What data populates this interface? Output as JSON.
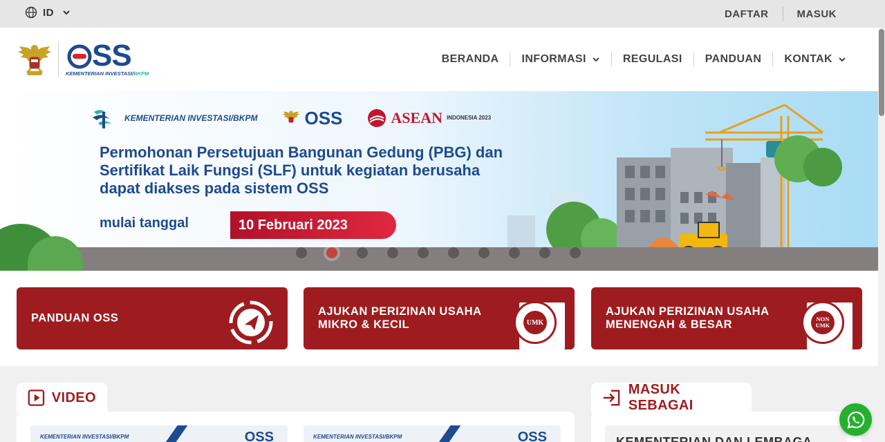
{
  "topbar": {
    "language": "ID",
    "links": [
      "DAFTAR",
      "MASUK"
    ]
  },
  "header": {
    "logo_text": "OSS",
    "logo_subtitle": "KEMENTERIAN INVESTASI/",
    "logo_subtitle_accent": "BKPM",
    "nav": [
      {
        "label": "BERANDA",
        "dropdown": false
      },
      {
        "label": "INFORMASI",
        "dropdown": true
      },
      {
        "label": "REGULASI",
        "dropdown": false
      },
      {
        "label": "PANDUAN",
        "dropdown": false
      },
      {
        "label": "KONTAK",
        "dropdown": true
      }
    ]
  },
  "banner": {
    "logo_kementerian": "KEMENTERIAN INVESTASI/BKPM",
    "logo_oss": "OSS",
    "logo_asean": "ASEAN",
    "logo_asean_sub": "INDONESIA 2023",
    "title": "Permohonan Persetujuan Bangunan Gedung (PBG) dan Sertifikat Laik Fungsi (SLF) untuk kegiatan berusaha dapat diakses pada sistem OSS",
    "date_prefix": "mulai tanggal",
    "date": "10 Februari 2023",
    "slide_count": 10,
    "active_slide": 1
  },
  "cards": [
    {
      "label": "PANDUAN OSS",
      "icon": "compass-icon"
    },
    {
      "label": "AJUKAN PERIZINAN USAHA MIKRO & KECIL",
      "icon": "umk-seal-icon",
      "seal": "UMK",
      "ring": "USAHA MIKRO & KECIL"
    },
    {
      "label": "AJUKAN PERIZINAN USAHA MENENGAH & BESAR",
      "icon": "non-umk-seal-icon",
      "seal": "NON UMK",
      "ring": "USAHA MENENGAH & BESAR"
    }
  ],
  "sections": {
    "video_title": "VIDEO",
    "masuk_title": "MASUK SEBAGAI",
    "masuk_first_option": "KEMENTERIAN DAN LEMBAGA",
    "video_thumb_kementerian": "KEMENTERIAN INVESTASI/BKPM",
    "video_thumb_oss": "OSS"
  },
  "colors": {
    "brand_red": "#9e1c1f",
    "brand_blue": "#1e4a8f",
    "whatsapp_green": "#25b02f"
  }
}
